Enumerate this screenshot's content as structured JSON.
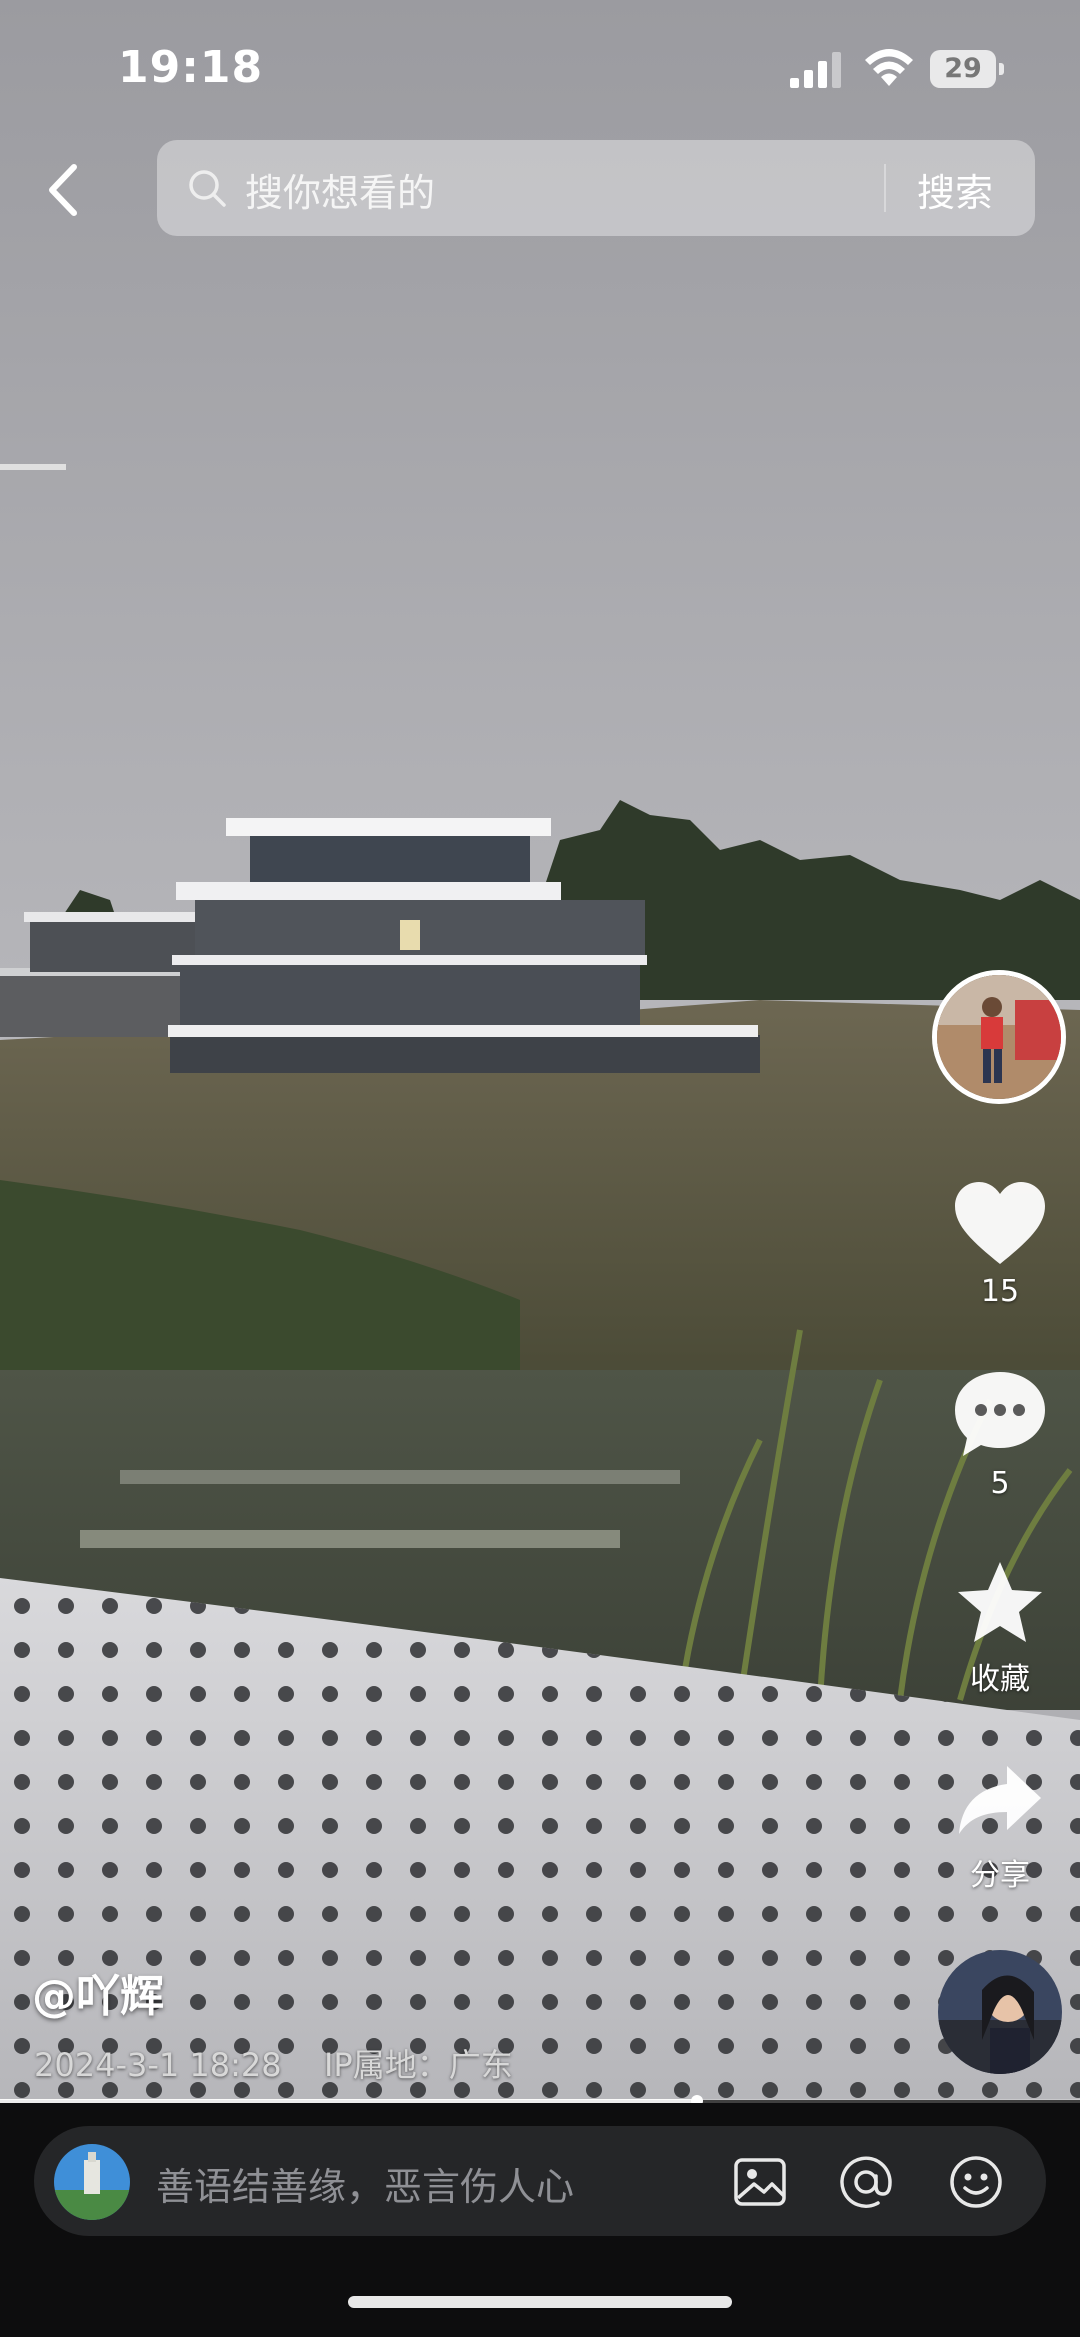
{
  "status_bar": {
    "time": "19:18",
    "battery": "29"
  },
  "search": {
    "placeholder": "搜你想看的",
    "button": "搜索"
  },
  "actions": {
    "likes": "15",
    "comments": "5",
    "favorite": "收藏",
    "share": "分享"
  },
  "post": {
    "author": "@吖辉",
    "date": "2024-3-1 18:28",
    "ip_location": "IP属地：广东"
  },
  "playback": {
    "progress": 0.645
  },
  "composer": {
    "placeholder": "善语结善缘，恶言伤人心"
  },
  "icons": [
    "back-icon",
    "search-icon",
    "heart-icon",
    "comment-icon",
    "star-icon",
    "share-icon",
    "image-icon",
    "at-icon",
    "emoji-icon"
  ],
  "colors": {
    "bottom_bar": "#0d0d0e",
    "composer": "#252628",
    "icon": "#ffffff"
  }
}
